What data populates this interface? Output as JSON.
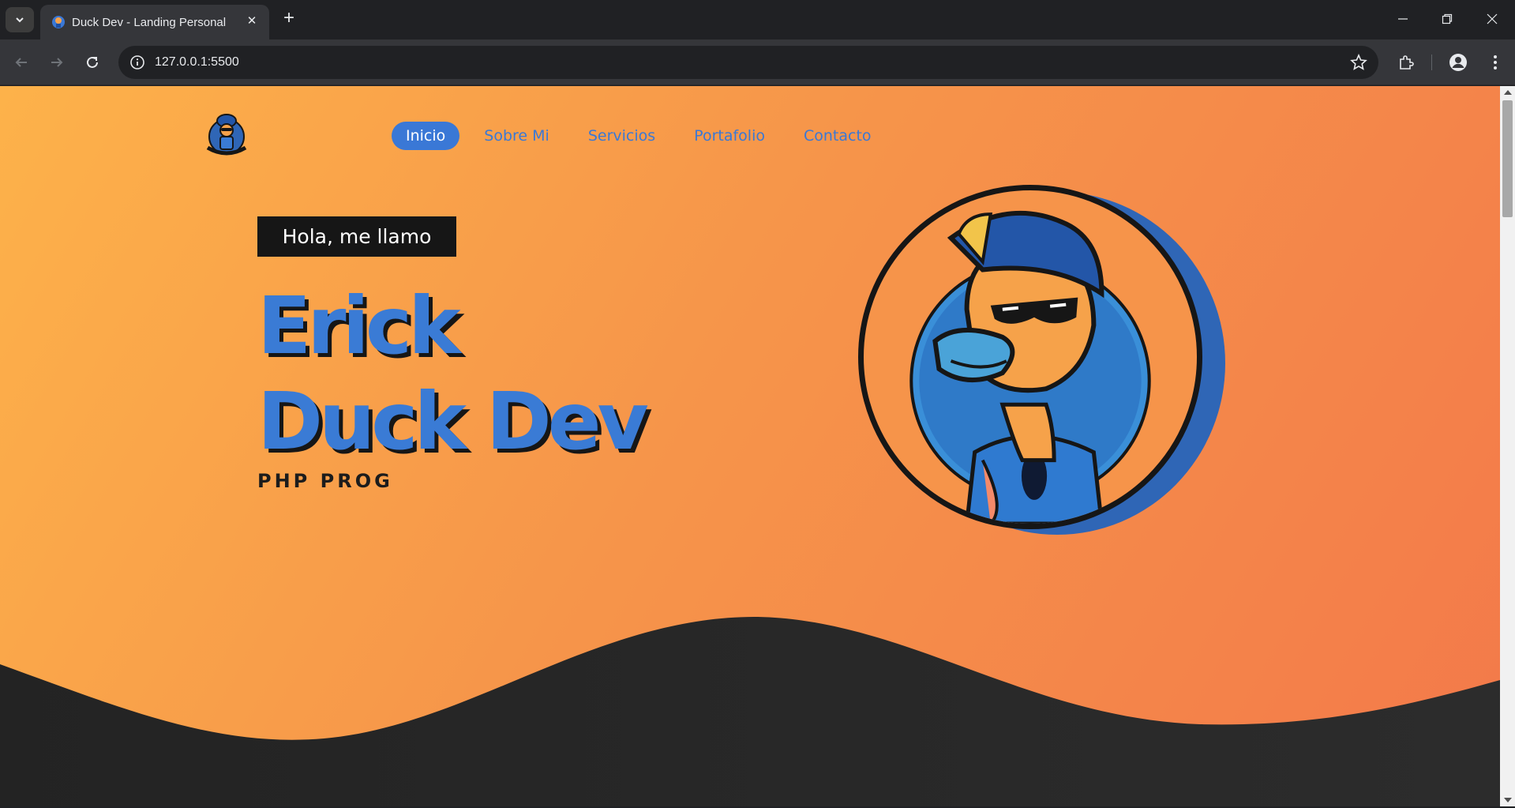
{
  "browser": {
    "tab_title": "Duck Dev - Landing Personal",
    "url": "127.0.0.1:5500"
  },
  "site": {
    "nav": [
      {
        "label": "Inicio",
        "active": true
      },
      {
        "label": "Sobre Mi",
        "active": false
      },
      {
        "label": "Servicios",
        "active": false
      },
      {
        "label": "Portafolio",
        "active": false
      },
      {
        "label": "Contacto",
        "active": false
      }
    ],
    "greeting": "Hola, me llamo",
    "name_line_1": "Erick",
    "name_line_2": "Duck Dev",
    "role": "PHP PROG"
  },
  "colors": {
    "accent_blue": "#3a78d6",
    "gradient_start": "#fdb24a",
    "gradient_end": "#f3794a",
    "dark": "#161616",
    "wave": "#262626"
  },
  "icons": [
    "tab-search-icon",
    "duck-favicon-icon",
    "close-icon",
    "plus-icon",
    "minimize-icon",
    "restore-icon",
    "window-close-icon",
    "back-arrow-icon",
    "forward-arrow-icon",
    "reload-icon",
    "site-info-icon",
    "bookmark-star-icon",
    "extensions-icon",
    "profile-icon",
    "kebab-menu-icon",
    "duckdev-logo"
  ]
}
